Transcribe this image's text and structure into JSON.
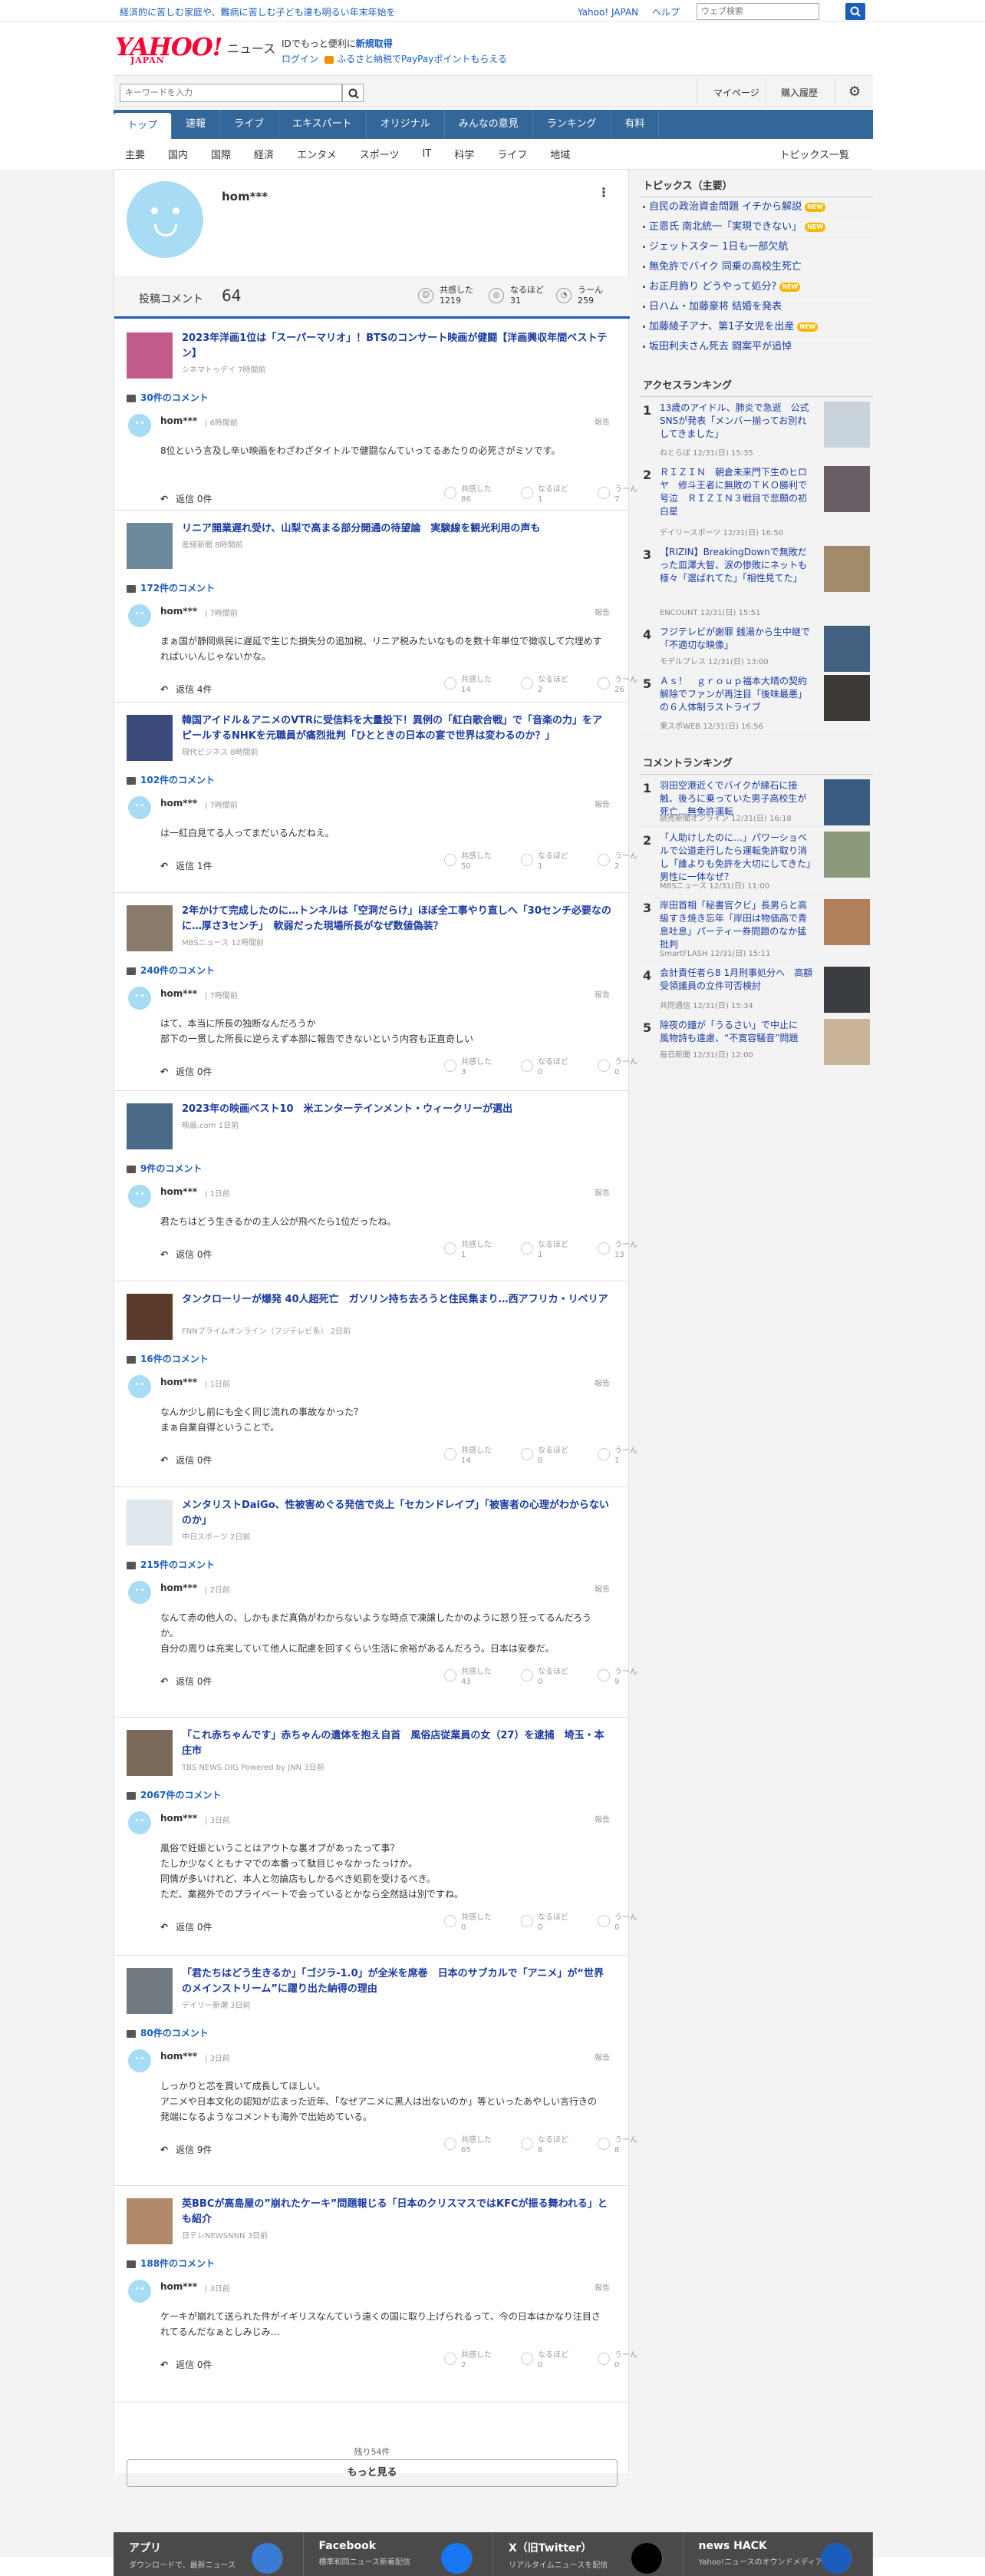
{
  "promo": {
    "text": "経済的に苦しむ家庭や、難病に苦しむ子ども達も明るい年末年始を",
    "links": [
      "Yahoo! JAPAN",
      "ヘルプ"
    ],
    "search_placeholder": "ウェブ検索"
  },
  "brand": {
    "logo": "YAHOO!",
    "logo_sub": "JAPAN",
    "name": "ニュース",
    "reg_prefix": "IDでもっと便利に",
    "reg_link": "新規取得",
    "login": "ログイン",
    "furusato": "ふるさと納税でPayPayポイントもらえる"
  },
  "search": {
    "placeholder": "キーワードを入力",
    "mypage": "マイページ",
    "buy": "購入履歴"
  },
  "nav": [
    "トップ",
    "速報",
    "ライブ",
    "エキスパート",
    "オリジナル",
    "みんなの意見",
    "ランキング",
    "有料"
  ],
  "subnav": [
    "主要",
    "国内",
    "国際",
    "経済",
    "エンタメ",
    "スポーツ",
    "IT",
    "科学",
    "ライフ",
    "地域"
  ],
  "subnav_all": "トピックス一覧",
  "profile": {
    "name": "hom***",
    "posts_label": "投稿コメント",
    "posts": "64",
    "reactions": [
      {
        "label": "共感した",
        "value": "1219"
      },
      {
        "label": "なるほど",
        "value": "31"
      },
      {
        "label": "うーん",
        "value": "259"
      }
    ]
  },
  "reply_label": "返信",
  "report": "報告",
  "rx_labels": [
    "共感した",
    "なるほど",
    "うーん"
  ],
  "items": [
    {
      "title": "2023年洋画1位は「スーパーマリオ」！BTSのコンサート映画が健闘【洋画興収年間ベストテン】",
      "src": "シネマトゥデイ 7時間前",
      "count": "30件のコメント",
      "user": "hom***",
      "time": "6時間前",
      "text": "8位という言及し辛い映画をわざわざタイトルで健闘なんていってるあたりの必死さがミソです。",
      "replies": "返信 0件",
      "r": [
        "86",
        "1",
        "7"
      ],
      "thumb": "#c25a8a"
    },
    {
      "title": "リニア開業遅れ受け、山梨で高まる部分開通の待望論　実験線を観光利用の声も",
      "src": "産経新聞 8時間前",
      "count": "172件のコメント",
      "user": "hom***",
      "time": "7時間前",
      "text": "まぁ国が静岡県民に遅延で生じた損失分の追加税、リニア税みたいなものを数十年単位で徴収して穴埋めすればいいんじゃないかな。",
      "replies": "返信 4件",
      "r": [
        "14",
        "2",
        "26"
      ],
      "thumb": "#6d8a9c"
    },
    {
      "title": "韓国アイドル＆アニメのVTRに受信料を大量投下！異例の「紅白歌合戦」で「音楽の力」をアピールするNHKを元職員が痛烈批判「ひとときの日本の宴で世界は変わるのか？」",
      "src": "現代ビジネス 8時間前",
      "count": "102件のコメント",
      "user": "hom***",
      "time": "7時間前",
      "text": "は一紅白見てる人ってまだいるんだねえ。",
      "replies": "返信 1件",
      "r": [
        "50",
        "1",
        "2"
      ],
      "thumb": "#3a4a7a"
    },
    {
      "title": "2年かけて完成したのに…トンネルは「空洞だらけ」ほぼ全工事やり直しへ「30センチ必要なのに…厚さ3センチ」　軟弱だった現場所長がなぜ数値偽装？",
      "src": "MBSニュース 12時間前",
      "count": "240件のコメント",
      "user": "hom***",
      "time": "7時間前",
      "text": "はて、本当に所長の独断なんだろうか\n部下の一贯した所長に逆らえず本部に報告できないという内容も正直奇しい",
      "replies": "返信 0件",
      "r": [
        "3",
        "0",
        "0"
      ],
      "thumb": "#8a7a6a"
    },
    {
      "title": "2023年の映画ベスト10　米エンターテインメント・ウィークリーが選出",
      "src": "映画.com 1日前",
      "count": "9件のコメント",
      "user": "hom***",
      "time": "1日前",
      "text": "君たちはどう生きるかの主人公が飛べたら1位だったね。",
      "replies": "返信 0件",
      "r": [
        "1",
        "1",
        "13"
      ],
      "thumb": "#4a6a8a"
    },
    {
      "title": "タンクローリーが爆発 40人超死亡　ガソリン持ち去ろうと住民集まり…西アフリカ・リベリア",
      "src": "FNNプライムオンライン（フジテレビ系） 2日前",
      "count": "16件のコメント",
      "user": "hom***",
      "time": "1日前",
      "text": "なんか少し前にも全く同じ流れの事故なかった？\nまぁ自業自得ということで。",
      "replies": "返信 0件",
      "r": [
        "14",
        "0",
        "1"
      ],
      "thumb": "#5a3a2a"
    },
    {
      "title": "メンタリストDaiGo、性被害めぐる発信で炎上「セカンドレイプ」「被害者の心理がわからないのか」",
      "src": "中日スポーツ 2日前",
      "count": "215件のコメント",
      "user": "hom***",
      "time": "2日前",
      "text": "なんて赤の他人の、しかもまだ真偽がわからないような時点で凍譲したかのように怒り狂ってるんだろうか。\n自分の周りは充実していて他人に配慮を回すくらい生活に余裕があるんだろう。日本は安泰だ。",
      "replies": "返信 0件",
      "r": [
        "43",
        "0",
        "9"
      ],
      "thumb": "#dfe6ec"
    },
    {
      "title": "「これ赤ちゃんです」赤ちゃんの遺体を抱え自首　風俗店従業員の女（27）を逮捕　埼玉・本庄市",
      "src": "TBS NEWS DIG Powered by JNN 3日前",
      "count": "2067件のコメント",
      "user": "hom***",
      "time": "3日前",
      "text": "風俗で妊娠ということはアウトな裏オプがあったって事？\nたしか少なくともナマでの本番って駄目じゃなかったっけか。\n同情が多いけれど、本人と勿論店もしかるべき処罰を受けるべき。\nただ、業務外でのプライベートで会っているとかなら全然話は別ですね。",
      "replies": "返信 0件",
      "r": [
        "0",
        "0",
        "0"
      ],
      "thumb": "#7a6a5a"
    },
    {
      "title": "「君たちはどう生きるか」「ゴジラ-1.0」が全米を席巻　日本のサブカルで「アニメ」が“世界のメインストリーム”に躍り出た納得の理由",
      "src": "デイリー新潮 3日前",
      "count": "80件のコメント",
      "user": "hom***",
      "time": "3日前",
      "text": "しっかりと芯を貫いて成長してほしい。\nアニメや日本文化の認知が広まった近年、「なぜアニメに黒人は出ないのか」等といったあやしい言行きの発端になるようなコメントも海外で出始めている。",
      "replies": "返信 9件",
      "r": [
        "65",
        "8",
        "8"
      ],
      "thumb": "#707a80"
    },
    {
      "title": "英BBCが高島屋の”崩れたケーキ”問題報じる「日本のクリスマスではKFCが振る舞われる」とも紹介",
      "src": "日テレNEWSNNN 3日前",
      "count": "188件のコメント",
      "user": "hom***",
      "time": "3日前",
      "text": "ケーキが崩れて送られた件がイギリスなんていう遠くの国に取り上げられるって、今の日本はかなり注目されてるんだなぁとしみじみ…",
      "replies": "返信 0件",
      "r": [
        "2",
        "0",
        "0"
      ],
      "thumb": "#b08a6a"
    }
  ],
  "remaining": "残り54件",
  "more": "もっと見る",
  "side": {
    "topics_head": "トピックス（主要）",
    "topics": [
      {
        "t": "自民の政治資金問題 イチから解説",
        "new": true
      },
      {
        "t": "正恩氏 南北統一「実現できない」",
        "new": true
      },
      {
        "t": "ジェットスター 1日も一部欠航",
        "new": false
      },
      {
        "t": "無免許でバイク 同乗の高校生死亡",
        "new": false
      },
      {
        "t": "お正月飾り どうやって処分?",
        "new": true
      },
      {
        "t": "日ハム・加藤豪将 結婚を発表",
        "new": false
      },
      {
        "t": "加藤綾子アナ、第1子女児を出産",
        "new": true
      },
      {
        "t": "坂田利夫さん死去 闘案平が追悼",
        "new": false
      }
    ],
    "new_label": "NEW",
    "access_head": "アクセスランキング",
    "access": [
      {
        "t": "13歳のアイドル、肺炎で急逝　公式SNSが発表「メンバー揃ってお別れしてきました」",
        "s": "ねとらぼ 12/31(日) 15:35"
      },
      {
        "t": "ＲＩＺＩＮ　朝倉未来門下生のヒロヤ　修斗王者に無敗のＴＫＯ勝利で号泣　ＲＩＺＩＮ３戦目で悲願の初白星",
        "s": "デイリースポーツ 12/31(日) 16:50"
      },
      {
        "t": "【RIZIN】BreakingDownで無敗だった皿澤大智、涙の惨敗にネットも様々「選ばれてた」「相性見てた」",
        "s": "ENCOUNT 12/31(日) 15:51"
      },
      {
        "t": "フジテレビが謝罪 銭湯から生中継で「不適切な映像」",
        "s": "モデルプレス 12/31(日) 13:00"
      },
      {
        "t": "Ａｓ！　ｇｒｏｕｐ福本大晴の契約解除でファンが再注目「後味最悪」の６人体制ラストライブ",
        "s": "東スポWEB 12/31(日) 16:56"
      }
    ],
    "comment_head": "コメントランキング",
    "comment": [
      {
        "t": "羽田空港近くでバイクが縁石に接触、後ろに乗っていた男子高校生が死亡…無免許運転",
        "s": "読売新聞オンライン 12/31(日) 16:18"
      },
      {
        "t": "「人助けしたのに…」パワーショベルで公道走行したら運転免許取り消し「誰よりも免許を大切にしてきた」男性に一体なぜ？",
        "s": "MBSニュース 12/31(日) 11:00"
      },
      {
        "t": "岸田首相「秘書官クビ」長男らと高級すき焼き忘年「岸田は物価高で青息吐息」パーティー券問題のなか猛批判",
        "s": "SmartFLASH 12/31(日) 15:11"
      },
      {
        "t": "会計責任者ら8 1月刑事処分へ　高額受領議員の立件可否検討",
        "s": "共同通信 12/31(日) 15:34"
      },
      {
        "t": "除夜の鐘が「うるさい」で中止に　風物詩も遠慮、“不寛容騒音”問題",
        "s": "毎日新聞 12/31(日) 12:00"
      }
    ]
  },
  "footer": [
    {
      "t": "アプリ",
      "s": "ダウンロードで、最新ニュース"
    },
    {
      "t": "Facebook",
      "s": "標準和同ニュース新着配信"
    },
    {
      "t": "X（旧Twitter）",
      "s": "リアルタイムニュースを配信"
    },
    {
      "t": "news HACK",
      "s": "Yahoo!ニュースのオウンドメディア"
    }
  ]
}
